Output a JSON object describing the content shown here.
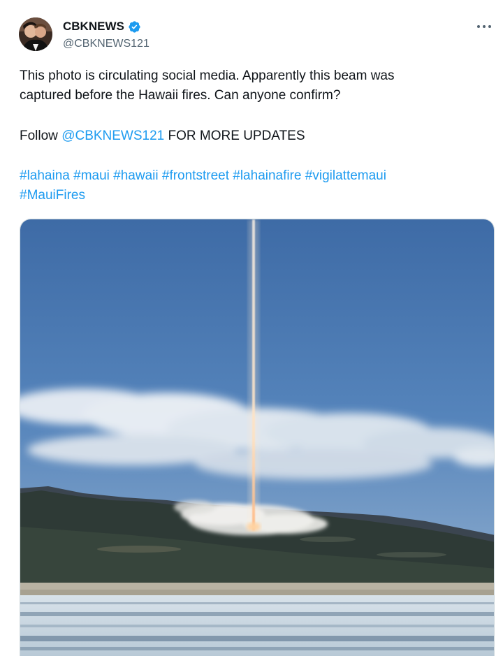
{
  "author": {
    "display_name": "CBKNEWS",
    "handle": "@CBKNEWS121",
    "verified": true
  },
  "icons": {
    "verified": "verified-badge-icon",
    "more": "more-options-icon"
  },
  "post": {
    "line1": "This photo is circulating social media. Apparently this beam was",
    "line2": "captured before the Hawaii fires. Can anyone confirm?",
    "follow_prefix": "Follow ",
    "follow_mention": "@CBKNEWS121",
    "follow_suffix": " FOR MORE UPDATES",
    "hashtags_line1": [
      "#lahaina",
      "#maui",
      "#hawaii",
      "#frontstreet",
      "#lahainafire",
      "#vigilattemaui"
    ],
    "hashtags_line2": [
      "#MauiFires"
    ]
  },
  "colors": {
    "accent": "#1d9bf0",
    "text": "#0f1419",
    "secondary": "#536471"
  }
}
